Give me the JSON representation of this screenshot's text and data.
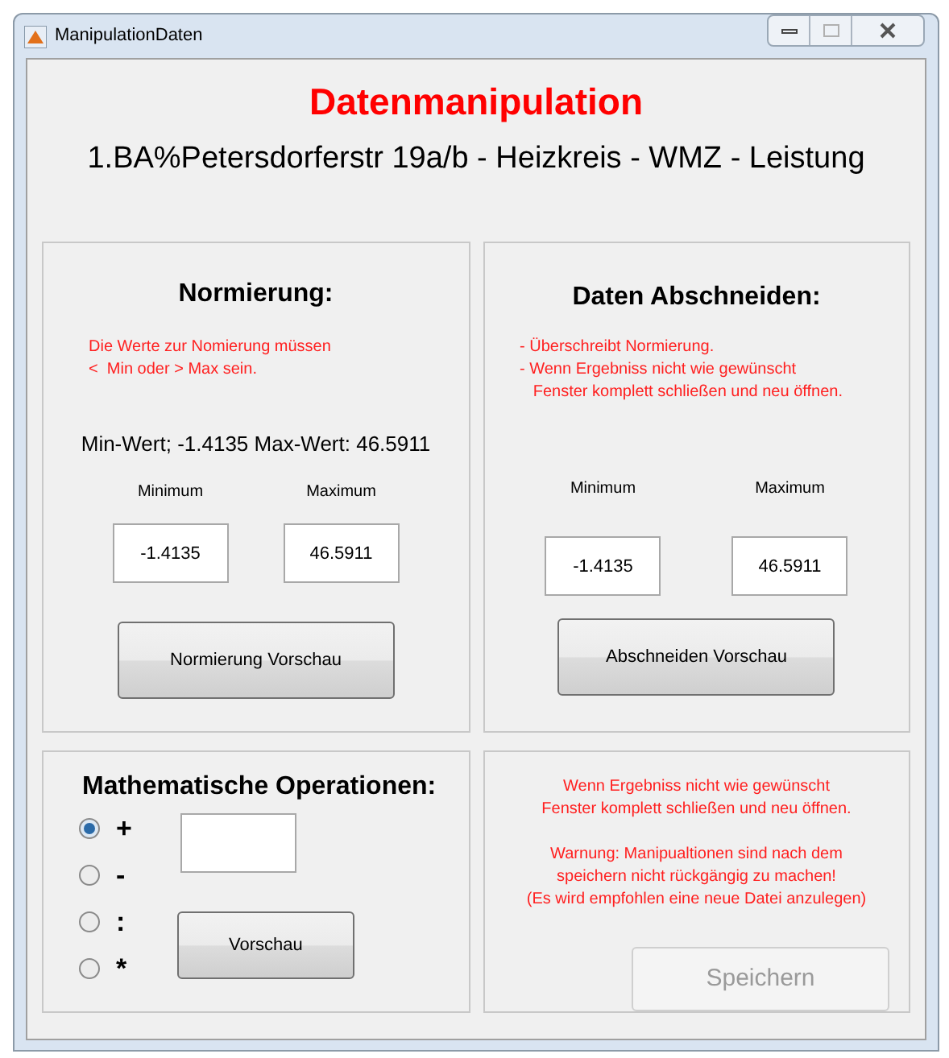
{
  "window": {
    "title": "ManipulationDaten"
  },
  "heading": "Datenmanipulation",
  "subtitle": "1.BA%Petersdorferstr 19a/b - Heizkreis - WMZ - Leistung",
  "normierung": {
    "title": "Normierung:",
    "hint_lines": [
      "Die Werte zur Nomierung müssen",
      "<  Min oder > Max sein."
    ],
    "range_text": "Min-Wert; -1.4135 Max-Wert: 46.5911",
    "min_label": "Minimum",
    "max_label": "Maximum",
    "min_value": "-1.4135",
    "max_value": "46.5911",
    "button": {
      "label": "Normierung Vorschau"
    }
  },
  "abschneiden": {
    "title": "Daten Abschneiden:",
    "hint_lines": [
      "- Überschreibt Normierung.",
      "- Wenn Ergebniss nicht wie gewünscht",
      "   Fenster komplett schließen und neu öffnen."
    ],
    "min_label": "Minimum",
    "max_label": "Maximum",
    "min_value": "-1.4135",
    "max_value": "46.5911",
    "button": {
      "label": "Abschneiden Vorschau"
    }
  },
  "math": {
    "title": "Mathematische Operationen:",
    "operations": [
      {
        "label": "+",
        "selected": true
      },
      {
        "label": "-",
        "selected": false
      },
      {
        "label": ":",
        "selected": false
      },
      {
        "label": "*",
        "selected": false
      }
    ],
    "button": {
      "label": "Vorschau"
    }
  },
  "save_panel": {
    "notices": [
      [
        "Wenn Ergebniss nicht wie gewünscht",
        "Fenster komplett schließen und neu öffnen."
      ],
      [
        "Warnung: Manipualtionen sind nach dem",
        "speichern nicht rückgängig zu machen!",
        "(Es wird empfohlen eine neue Datei anzulegen)"
      ]
    ],
    "button": {
      "label": "Speichern",
      "disabled": true
    }
  }
}
